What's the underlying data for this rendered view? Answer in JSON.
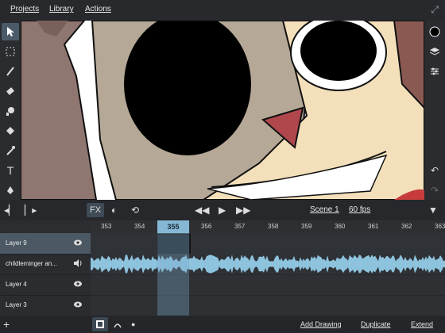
{
  "menu": {
    "projects": "Projects",
    "library": "Library",
    "actions": "Actions"
  },
  "icons": {
    "expand": "↗",
    "tools": [
      "select-arrow-icon",
      "lasso-select-icon",
      "brush-icon",
      "eraser-icon",
      "smudge-icon",
      "fill-icon",
      "eyedropper-icon",
      "text-icon",
      "pen-icon"
    ],
    "right": [
      "color-dot-icon",
      "layers-icon",
      "adjust-icon",
      "undo-icon",
      "redo-icon",
      "collapse-icon"
    ]
  },
  "controls": {
    "fx_label": "FX",
    "scene": "Scene 1",
    "fps": "60 fps"
  },
  "timeline": {
    "frames": [
      "353",
      "354",
      "355",
      "356",
      "357",
      "358",
      "359",
      "360",
      "361",
      "362",
      "363"
    ],
    "current": "355"
  },
  "layers": [
    {
      "name": "Layer 9",
      "icon": "eye-icon",
      "selected": true
    },
    {
      "name": "childleminger an...",
      "icon": "speaker-icon",
      "selected": false
    },
    {
      "name": "Layer 4",
      "icon": "eye-icon",
      "selected": false
    },
    {
      "name": "Layer 3",
      "icon": "eye-icon",
      "selected": false
    }
  ],
  "bottom": {
    "add_drawing": "Add Drawing",
    "duplicate": "Duplicate",
    "extend": "Extend"
  }
}
